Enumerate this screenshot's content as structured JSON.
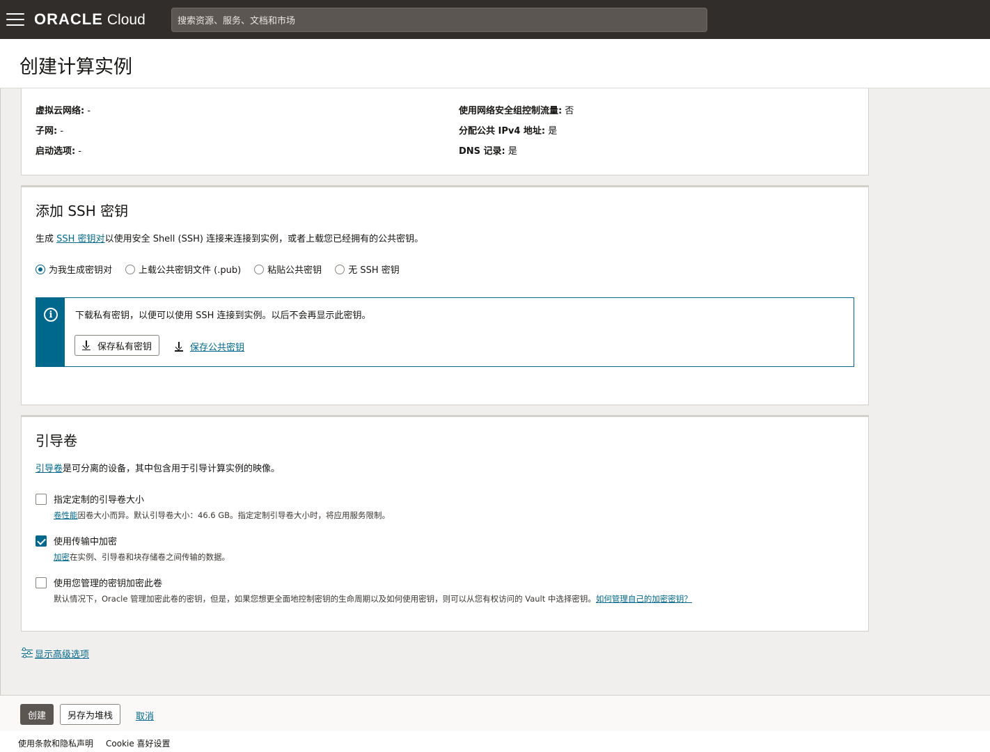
{
  "header": {
    "brand": "ORACLE",
    "product": "Cloud",
    "search_placeholder": "搜索资源、服务、文档和市场"
  },
  "page": {
    "title": "创建计算实例"
  },
  "networking": {
    "vcn_label": "虚拟云网络:",
    "vcn_value": "-",
    "subnet_label": "子网:",
    "subnet_value": "-",
    "launch_label": "启动选项:",
    "launch_value": "-",
    "nsg_label": "使用网络安全组控制流量:",
    "nsg_value": "否",
    "ipv4_label": "分配公共 IPv4 地址:",
    "ipv4_value": "是",
    "dns_label": "DNS 记录:",
    "dns_value": "是"
  },
  "ssh": {
    "title": "添加 SSH 密钥",
    "desc_prefix": "生成 ",
    "desc_link": "SSH 密钥对",
    "desc_suffix": "以使用安全 Shell (SSH) 连接来连接到实例，或者上载您已经拥有的公共密钥。",
    "options": [
      {
        "label": "为我生成密钥对",
        "checked": true
      },
      {
        "label": "上载公共密钥文件 (.pub)",
        "checked": false
      },
      {
        "label": "粘贴公共密钥",
        "checked": false
      },
      {
        "label": "无 SSH 密钥",
        "checked": false
      }
    ],
    "info_text": "下载私有密钥，以便可以使用 SSH 连接到实例。以后不会再显示此密钥。",
    "save_private": "保存私有密钥",
    "save_public": "保存公共密钥"
  },
  "boot": {
    "title": "引导卷",
    "desc_link": "引导卷",
    "desc_suffix": "是可分离的设备，其中包含用于引导计算实例的映像。",
    "opt1_label": "指定定制的引导卷大小",
    "opt1_help_link": "卷性能",
    "opt1_help": "因卷大小而异。默认引导卷大小：46.6 GB。指定定制引导卷大小时，将应用服务限制。",
    "opt2_label": "使用传输中加密",
    "opt2_help_link": "加密",
    "opt2_help": "在实例、引导卷和块存储卷之间传输的数据。",
    "opt3_label": "使用您管理的密钥加密此卷",
    "opt3_help": "默认情况下，Oracle 管理加密此卷的密钥，但是，如果您想更全面地控制密钥的生命周期以及如何使用密钥，则可以从您有权访问的 Vault 中选择密钥。",
    "opt3_help_link": "如何管理自己的加密密钥？"
  },
  "advanced_label": "显示高级选项",
  "actions": {
    "create": "创建",
    "save_stack": "另存为堆栈",
    "cancel": "取消"
  },
  "footer": {
    "terms": "使用条款和隐私声明",
    "cookie": "Cookie 喜好设置"
  },
  "colors": {
    "accent": "#00688c",
    "topbar": "#312d2a"
  }
}
